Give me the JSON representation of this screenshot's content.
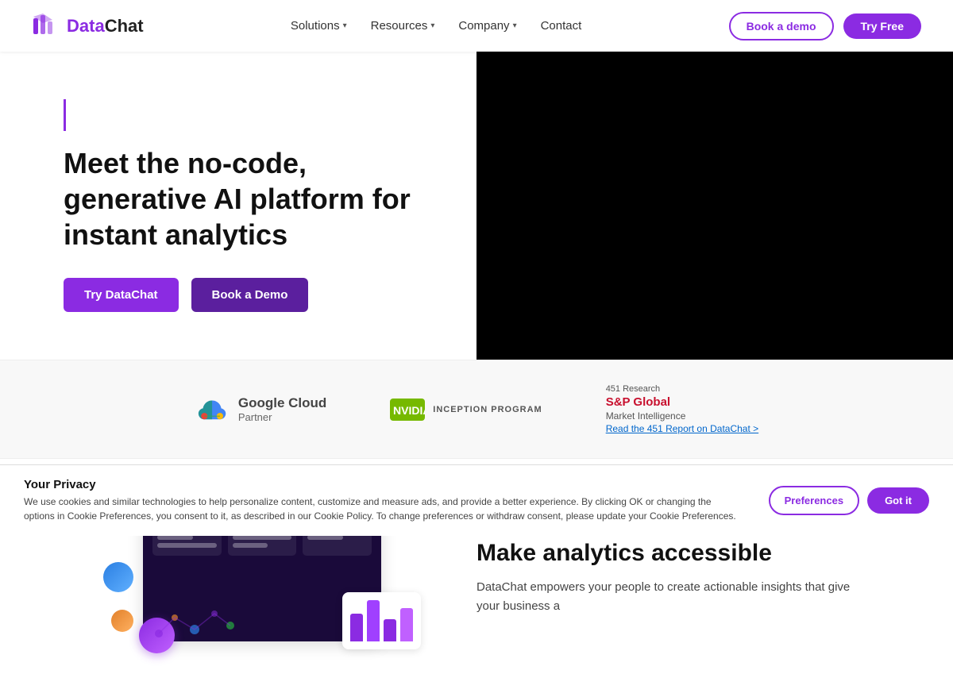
{
  "navbar": {
    "logo_data": "DataChat",
    "logo_data_part": "Data",
    "logo_chat_part": "Chat",
    "nav_items": [
      {
        "label": "Solutions",
        "has_dropdown": true
      },
      {
        "label": "Resources",
        "has_dropdown": true
      },
      {
        "label": "Company",
        "has_dropdown": true
      },
      {
        "label": "Contact",
        "has_dropdown": false
      }
    ],
    "book_demo_label": "Book a demo",
    "try_free_label": "Try Free"
  },
  "hero": {
    "accent": true,
    "title": "Meet the no-code, generative AI platform for instant analytics",
    "cta_primary": "Try DataChat",
    "cta_secondary": "Book a Demo"
  },
  "partners": [
    {
      "id": "google-cloud",
      "name": "Google Cloud",
      "sub": "Partner"
    },
    {
      "id": "nvidia",
      "name": "NVIDIA",
      "sub": "INCEPTION PROGRAM"
    },
    {
      "id": "sp-global",
      "research": "451 Research",
      "brand_sp": "S&P",
      "brand_global": "Global",
      "intel_label": "Market Intelligence",
      "link": "Read the 451 Report on DataChat >"
    }
  ],
  "analytics_section": {
    "title": "Make analytics accessible",
    "description": "DataChat empowers your people to create actionable insights that give your business a"
  },
  "cookie_banner": {
    "title": "Your Privacy",
    "text": "We use cookies and similar technologies to help personalize content, customize and measure ads, and provide a better experience. By clicking OK or changing the options in Cookie Preferences, you consent to it, as described in our Cookie Policy. To change preferences or withdraw consent, please update your Cookie Preferences.",
    "preferences_label": "Preferences",
    "gotit_label": "Got it"
  }
}
